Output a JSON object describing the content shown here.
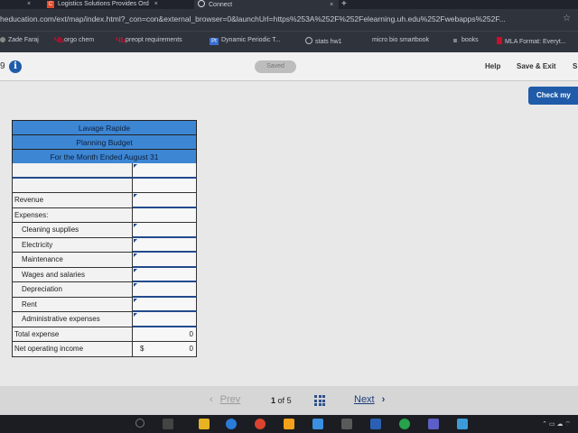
{
  "browser": {
    "tabs": [
      {
        "label": "Logistics Solutions Provides Ord",
        "close": "×"
      },
      {
        "label": "Connect",
        "close": "×"
      }
    ],
    "first_tab_close": "×",
    "new_tab": "+",
    "url": "heducation.com/ext/map/index.html?_con=con&external_browser=0&launchUrl=https%253A%252F%252Felearning.uh.edu%252Fwebapps%252F...",
    "star": "☆",
    "bookmarks": [
      {
        "label": "Zade Faraj",
        "icon": "bookmark-icon",
        "color": "#888888"
      },
      {
        "label": "orgo chem",
        "icon": "uh-icon",
        "color": "#c8102e"
      },
      {
        "label": "preopt requirements",
        "icon": "uh-icon",
        "color": "#c8102e"
      },
      {
        "label": "Dynamic Periodic T...",
        "icon": "periodic-icon",
        "color": "#3b6fd1"
      },
      {
        "label": "stats hw1",
        "icon": "globe-icon",
        "color": "#777777"
      },
      {
        "label": "micro bio smartbook",
        "icon": "none",
        "color": "#777777"
      },
      {
        "label": "books",
        "icon": "books-icon",
        "color": "#e0e0e0"
      },
      {
        "label": "MLA Format: Everyt...",
        "icon": "mla-icon",
        "color": "#c8102e"
      }
    ]
  },
  "app": {
    "question_number": "9",
    "info": "i",
    "saved": "Saved",
    "help": "Help",
    "save_exit": "Save & Exit",
    "s_cut": "S",
    "check": "Check my"
  },
  "budget": {
    "headers": [
      "Lavage Rapide",
      "Planning Budget",
      "For the Month Ended August 31"
    ],
    "rows": [
      {
        "label": "",
        "value": ""
      },
      {
        "label": "Revenue",
        "value": ""
      },
      {
        "label": "Expenses:",
        "value": ""
      },
      {
        "label": "Cleaning supplies",
        "value": ""
      },
      {
        "label": "Electricity",
        "value": ""
      },
      {
        "label": "Maintenance",
        "value": ""
      },
      {
        "label": "Wages and salaries",
        "value": ""
      },
      {
        "label": "Depreciation",
        "value": ""
      },
      {
        "label": "Rent",
        "value": ""
      },
      {
        "label": "Administrative expenses",
        "value": ""
      },
      {
        "label": "Total expense",
        "value": "0"
      },
      {
        "label": "Net operating income",
        "dollar": "$",
        "value": "0"
      }
    ]
  },
  "pager": {
    "prev": "Prev",
    "prev_chevron": "‹",
    "current": "1",
    "of": "of",
    "total": "5",
    "next": "Next",
    "next_chevron": "›"
  }
}
